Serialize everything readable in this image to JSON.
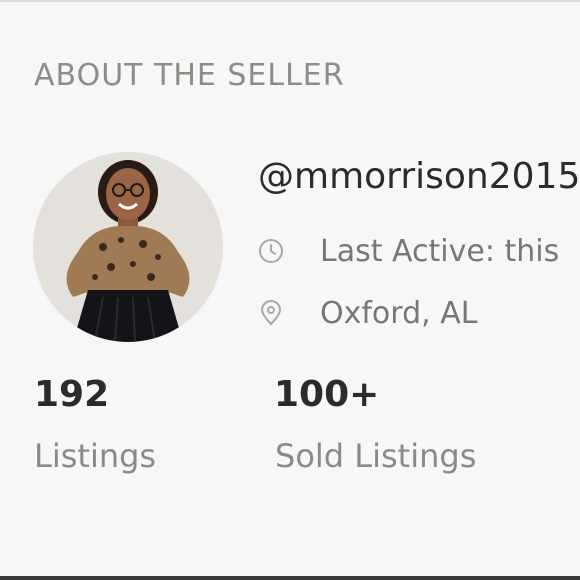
{
  "section": {
    "title": "ABOUT THE SELLER"
  },
  "seller": {
    "username": "@mmorrison2015",
    "last_active": "Last Active: this",
    "location": "Oxford, AL",
    "clock_icon": "clock-icon",
    "pin_icon": "location-pin-icon"
  },
  "stats": [
    {
      "value": "192",
      "label": "Listings"
    },
    {
      "value": "100+",
      "label": "Sold Listings"
    }
  ],
  "colors": {
    "background": "#f7f7f8",
    "title": "#8f8c87",
    "text_dark": "#2b2b2e",
    "text_muted": "#77767a"
  }
}
